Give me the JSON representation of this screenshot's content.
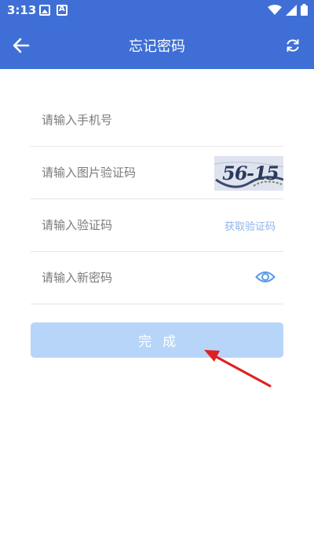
{
  "status_bar": {
    "time": "3:13",
    "left_icons": [
      "image-notification-icon",
      "a-notification-icon"
    ],
    "right_icons": [
      "wifi-icon",
      "signal-icon",
      "battery-icon"
    ]
  },
  "app_bar": {
    "title": "忘记密码",
    "back_icon": "arrow-left-icon",
    "refresh_icon": "refresh-icon",
    "background": "#3f6fd6"
  },
  "form": {
    "phone": {
      "placeholder": "请输入手机号",
      "value": ""
    },
    "image_captcha": {
      "placeholder": "请输入图片验证码",
      "value": "",
      "captcha_text": "56-15"
    },
    "sms_code": {
      "placeholder": "请输入验证码",
      "value": "",
      "get_code_label": "获取验证码"
    },
    "new_password": {
      "placeholder": "请输入新密码",
      "value": "",
      "eye_icon": "eye-icon"
    }
  },
  "submit": {
    "label": "完成",
    "background": "#b7d5f8"
  },
  "annotation": {
    "arrow_color": "#e02020"
  }
}
